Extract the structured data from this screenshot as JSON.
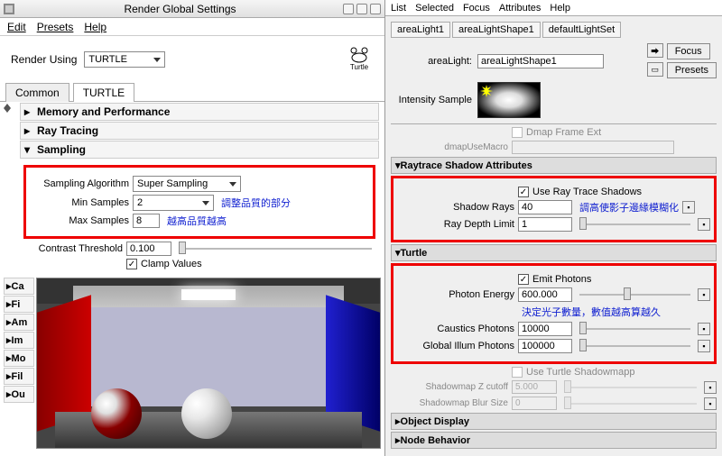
{
  "left": {
    "title": "Render Global Settings",
    "menu": {
      "edit": "Edit",
      "presets": "Presets",
      "help": "Help"
    },
    "renderUsingLabel": "Render Using",
    "renderUsingValue": "TURTLE",
    "turtleLogoText": "Turtle",
    "tabs": {
      "common": "Common",
      "turtle": "TURTLE"
    },
    "sections": {
      "memory": "Memory and Performance",
      "rayTracing": "Ray Tracing",
      "sampling": "Sampling"
    },
    "sampling": {
      "algoLabel": "Sampling Algorithm",
      "algoValue": "Super Sampling",
      "minLabel": "Min Samples",
      "minValue": "2",
      "anno1": "調整品質的部分",
      "maxLabel": "Max Samples",
      "maxValue": "8",
      "anno2": "越高品質越高",
      "contrastLabel": "Contrast Threshold",
      "contrastValue": "0.100",
      "clampLabel": "Clamp Values"
    },
    "collapsed": [
      "Ca",
      "Fi",
      "Am",
      "Im",
      "Mo",
      "Fil",
      "Ou"
    ]
  },
  "right": {
    "menu": {
      "list": "List",
      "selected": "Selected",
      "focus": "Focus",
      "attributes": "Attributes",
      "help": "Help"
    },
    "tabs": {
      "t1": "areaLight1",
      "t2": "areaLightShape1",
      "t3": "defaultLightSet"
    },
    "areaLightLabel": "areaLight:",
    "areaLightValue": "areaLightShape1",
    "btnFocus": "Focus",
    "btnPresets": "Presets",
    "intensityLabel": "Intensity Sample",
    "dmap": {
      "frameExt": "Dmap Frame Ext",
      "useMacro": "dmapUseMacro"
    },
    "raytrace": {
      "header": "Raytrace Shadow Attributes",
      "useRTS": "Use Ray Trace Shadows",
      "shadowRaysLabel": "Shadow Rays",
      "shadowRaysValue": "40",
      "anno": "調高使影子邊緣模糊化",
      "rayDepthLabel": "Ray Depth Limit",
      "rayDepthValue": "1"
    },
    "turtle": {
      "header": "Turtle",
      "emitPhotons": "Emit Photons",
      "photonEnergyLabel": "Photon Energy",
      "photonEnergyValue": "600.000",
      "anno": "決定光子數量，數值越高算越久",
      "causticsLabel": "Caustics Photons",
      "causticsValue": "10000",
      "giLabel": "Global Illum Photons",
      "giValue": "100000",
      "useTurtleSM": "Use Turtle Shadowmapp",
      "smZLabel": "Shadowmap Z cutoff",
      "smZValue": "5.000",
      "smBlurLabel": "Shadowmap Blur Size",
      "smBlurValue": "0"
    },
    "objDisplay": "Object Display",
    "nodeBehavior": "Node Behavior"
  }
}
